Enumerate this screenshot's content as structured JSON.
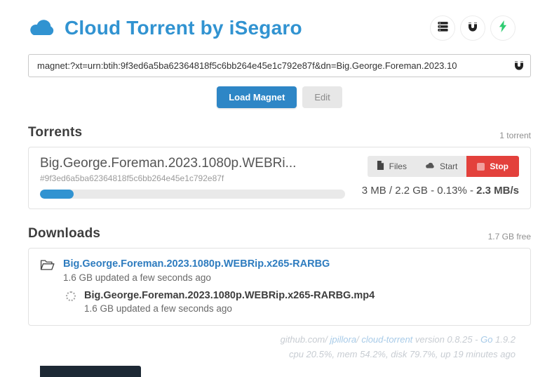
{
  "header": {
    "title": "Cloud Torrent by iSegaro",
    "icons": [
      {
        "name": "server-icon"
      },
      {
        "name": "magnet-icon"
      },
      {
        "name": "bolt-icon"
      }
    ]
  },
  "magnet_form": {
    "input_value": "magnet:?xt=urn:btih:9f3ed6a5ba62364818f5c6bb264e45e1c792e87f&dn=Big.George.Foreman.2023.10",
    "load_button": "Load Magnet",
    "edit_button": "Edit"
  },
  "torrents_section": {
    "title": "Torrents",
    "count_label": "1 torrent",
    "torrent": {
      "name": "Big.George.Foreman.2023.1080p.WEBRi...",
      "hash": "#9f3ed6a5ba62364818f5c6bb264e45e1c792e87f",
      "progress_percent": 11,
      "files_button": "Files",
      "start_button": "Start",
      "stop_button": "Stop",
      "stats_prefix": "3 MB / 2.2 GB - 0.13% - ",
      "speed": "2.3 MB/s"
    }
  },
  "downloads_section": {
    "title": "Downloads",
    "free_label": "1.7 GB free",
    "folder": {
      "name": "Big.George.Foreman.2023.1080p.WEBRip.x265-RARBG",
      "meta": "1.6 GB updated a few seconds ago"
    },
    "file": {
      "name": "Big.George.Foreman.2023.1080p.WEBRip.x265-RARBG.mp4",
      "meta": "1.6 GB updated a few seconds ago"
    }
  },
  "footer": {
    "line1_prefix": "github.com/ ",
    "link_user": "jpillora",
    "line1_sep": "/ ",
    "link_repo": "cloud-torrent",
    "line1_mid": " version 0.8.25 - ",
    "link_go": "Go",
    "line1_suffix": " 1.9.2",
    "line2": "cpu 20.5%, mem 54.2%, disk 79.7%, up 19 minutes ago"
  },
  "colors": {
    "brand_blue": "#3193d1",
    "button_blue": "#2e86c6",
    "stop_red": "#e3413c",
    "bolt_green": "#2ecc71",
    "link_blue": "#2e7cbf",
    "footer_gray": "#c7ccd2",
    "footer_link_blue": "#a8cbe8"
  }
}
